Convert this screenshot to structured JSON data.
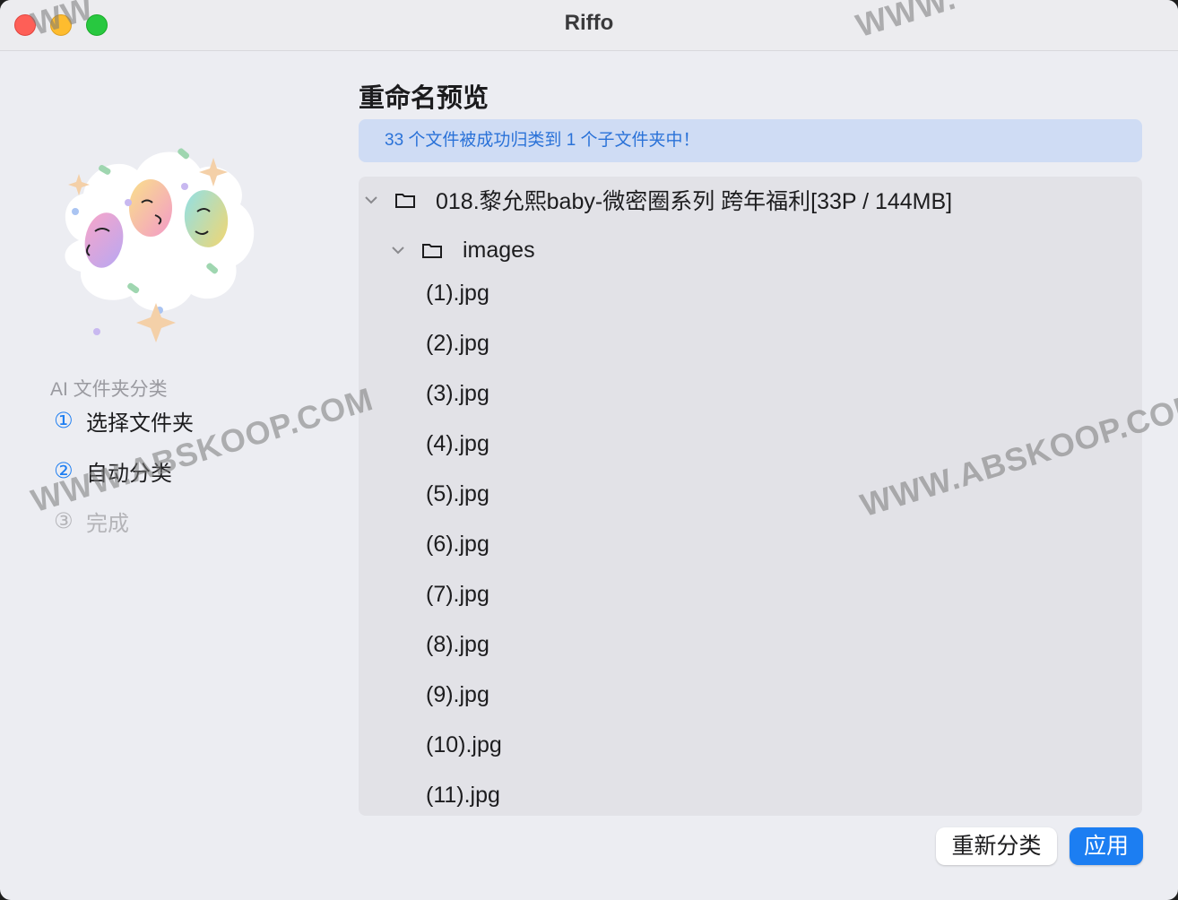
{
  "window": {
    "title": "Riffo"
  },
  "sidebar": {
    "section_label": "AI 文件夹分类",
    "steps": [
      {
        "number": "①",
        "label": "选择文件夹",
        "state": "done"
      },
      {
        "number": "②",
        "label": "自动分类",
        "state": "active"
      },
      {
        "number": "③",
        "label": "完成",
        "state": "pending"
      }
    ]
  },
  "main": {
    "title": "重命名预览",
    "banner": "33 个文件被成功归类到 1 个子文件夹中！",
    "tree": {
      "root_folder": "018.黎允熙baby-微密圈系列  跨年福利[33P / 144MB]",
      "sub_folder": "images",
      "files": [
        "(1).jpg",
        "(2).jpg",
        "(3).jpg",
        "(4).jpg",
        "(5).jpg",
        "(6).jpg",
        "(7).jpg",
        "(8).jpg",
        "(9).jpg",
        "(10).jpg",
        "(11).jpg"
      ]
    }
  },
  "footer": {
    "reclassify_label": "重新分类",
    "apply_label": "应用"
  },
  "watermarks": [
    "WWW.ABSKOOP.COM",
    "WWW.ABSKOOP.COM",
    "WW",
    "WWW."
  ],
  "colors": {
    "accent": "#1e7ef2",
    "banner_bg": "#cfdcf4",
    "banner_text": "#2a72d8"
  }
}
